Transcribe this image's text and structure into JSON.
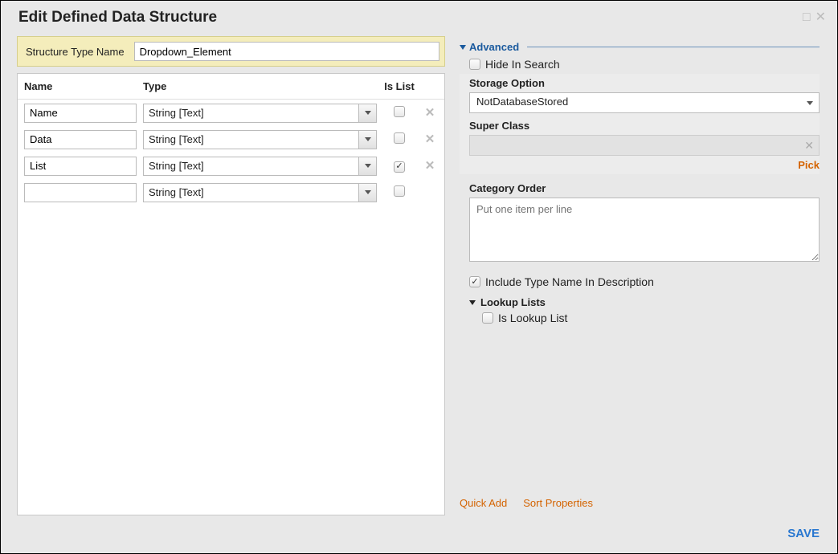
{
  "title": "Edit Defined Data Structure",
  "structure_type_name_label": "Structure Type Name",
  "structure_type_name_value": "Dropdown_Element",
  "grid": {
    "headers": {
      "name": "Name",
      "type": "Type",
      "is_list": "Is List"
    },
    "rows": [
      {
        "name": "Name",
        "type": "String [Text]",
        "is_list": false,
        "deletable": true
      },
      {
        "name": "Data",
        "type": "String [Text]",
        "is_list": false,
        "deletable": true
      },
      {
        "name": "List",
        "type": "String [Text]",
        "is_list": true,
        "deletable": true
      },
      {
        "name": "",
        "type": "String [Text]",
        "is_list": false,
        "deletable": false
      }
    ]
  },
  "advanced": {
    "section_label": "Advanced",
    "hide_in_search": {
      "label": "Hide In Search",
      "checked": false
    },
    "storage_option": {
      "label": "Storage Option",
      "value": "NotDatabaseStored"
    },
    "super_class": {
      "label": "Super Class",
      "value": "",
      "pick_label": "Pick"
    },
    "category_order": {
      "label": "Category Order",
      "placeholder": "Put one item per line",
      "value": ""
    },
    "include_type_name": {
      "label": "Include Type Name In Description",
      "checked": true
    },
    "lookup_lists": {
      "section_label": "Lookup Lists",
      "is_lookup_list": {
        "label": "Is Lookup List",
        "checked": false
      }
    }
  },
  "links": {
    "quick_add": "Quick Add",
    "sort_properties": "Sort Properties"
  },
  "footer": {
    "save": "SAVE"
  }
}
